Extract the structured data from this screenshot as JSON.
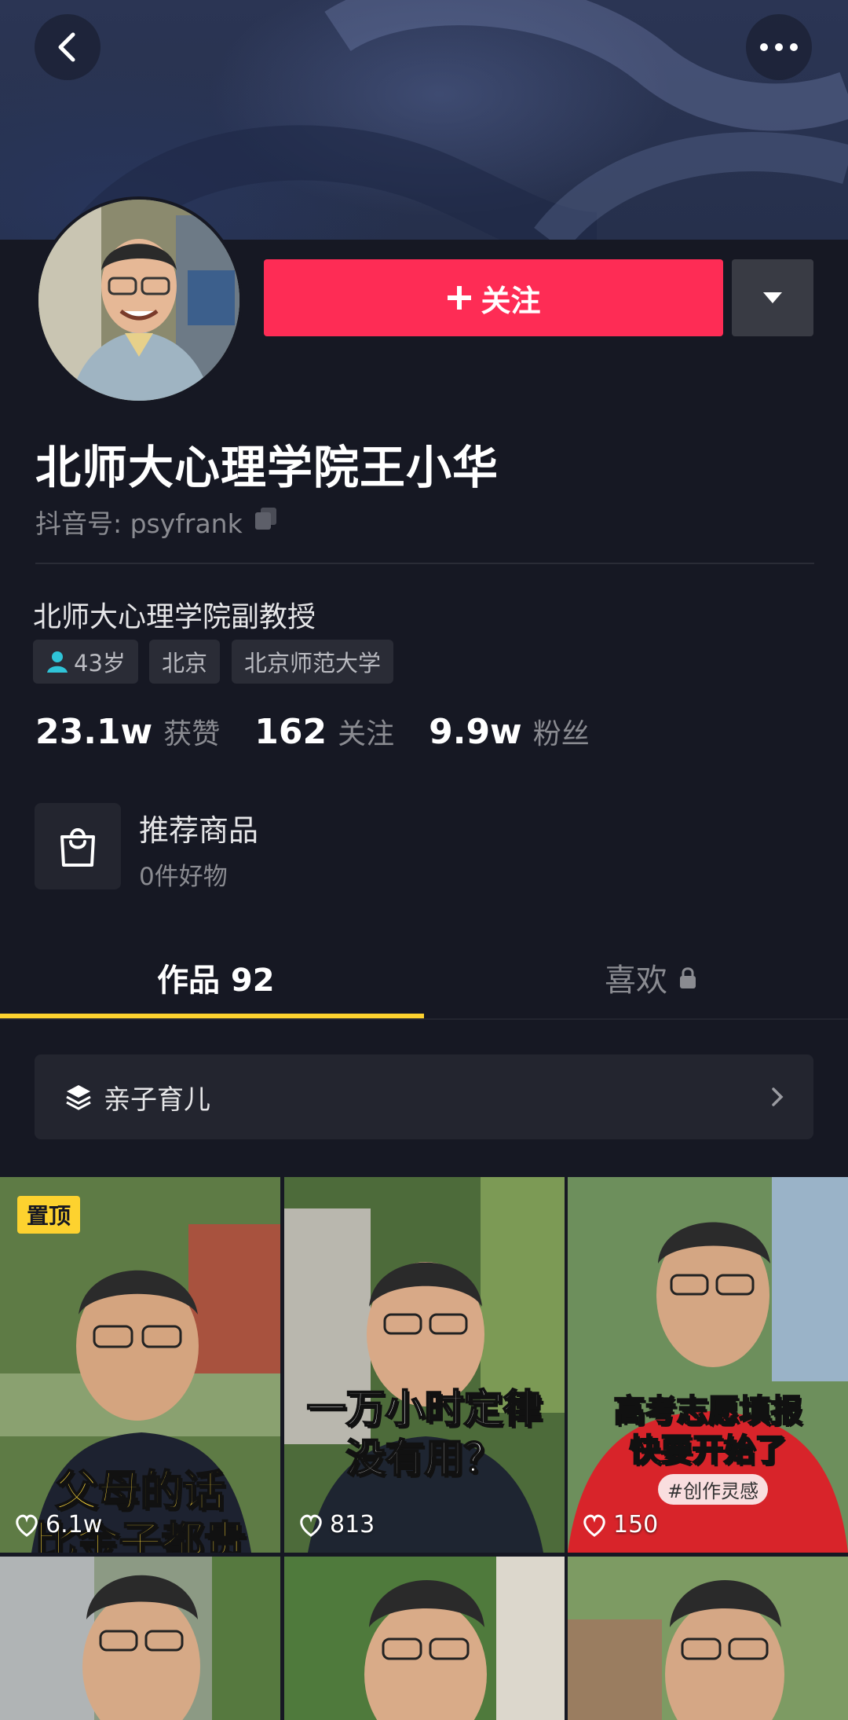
{
  "header": {
    "back_icon": "chevron-left-icon",
    "more_icon": "more-dots-icon"
  },
  "profile": {
    "name": "北师大心理学院王小华",
    "douyin_id_label": "抖音号: psyfrank",
    "bio": "北师大心理学院副教授",
    "tags": [
      {
        "label": "43岁",
        "icon": "person-icon",
        "icon_color": "#2fc4d8"
      },
      {
        "label": "北京"
      },
      {
        "label": "北京师范大学"
      }
    ],
    "stats": [
      {
        "value": "23.1w",
        "label": "获赞"
      },
      {
        "value": "162",
        "label": "关注"
      },
      {
        "value": "9.9w",
        "label": "粉丝"
      }
    ]
  },
  "actions": {
    "follow_label": "关注",
    "follow_color": "#fe2c55"
  },
  "shop": {
    "title": "推荐商品",
    "subtitle": "0件好物"
  },
  "tabs": [
    {
      "label": "作品 92",
      "active": true
    },
    {
      "label": "喜欢",
      "locked": true
    }
  ],
  "accent_color": "#fdd22f",
  "collection": {
    "label": "亲子育儿"
  },
  "videos": [
    {
      "pinned_label": "置顶",
      "likes": "6.1w",
      "caption": [
        "父母的话",
        "比金子都贵"
      ]
    },
    {
      "likes": "813",
      "caption": [
        "一万小时定律",
        "没有用？"
      ]
    },
    {
      "likes": "150",
      "caption": [
        "高考志愿填报",
        "快要开始了"
      ],
      "chip": "#创作灵感"
    },
    {},
    {},
    {}
  ]
}
